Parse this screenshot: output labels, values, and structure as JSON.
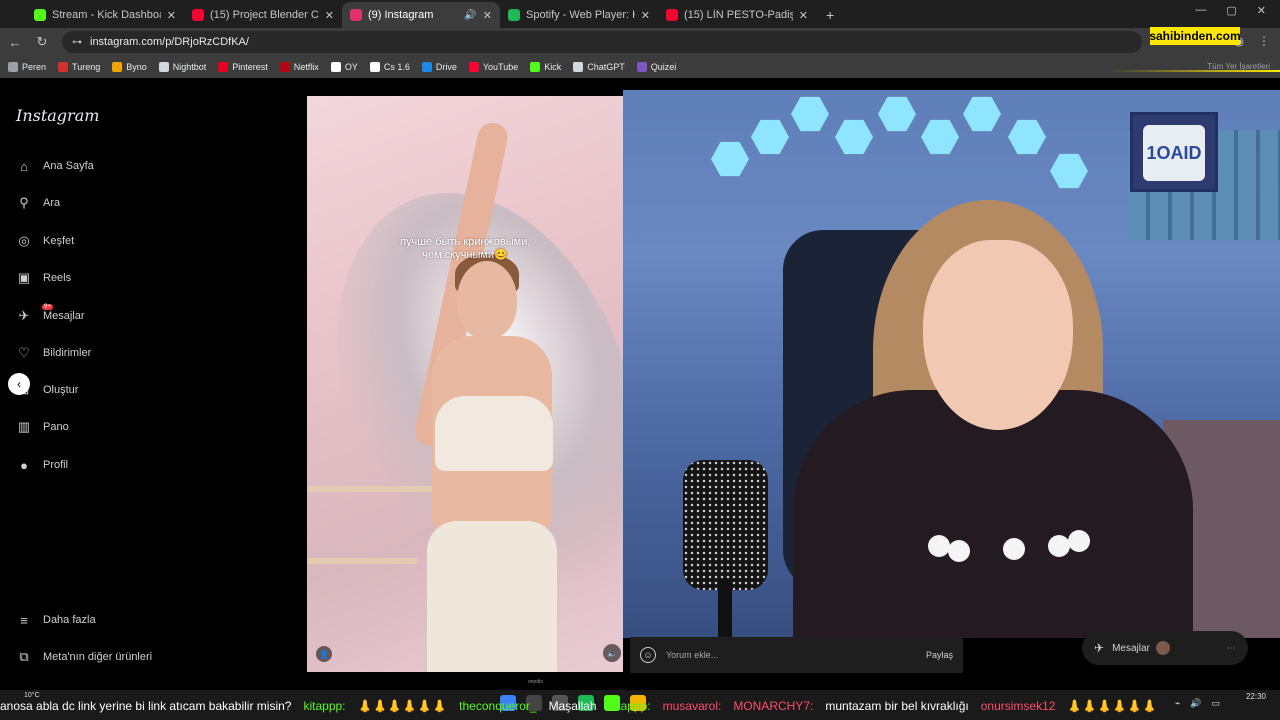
{
  "browser": {
    "tabs": [
      {
        "title": "Stream - Kick Dashboard",
        "icon": "kick-icon",
        "color": "#53fc18",
        "active": false
      },
      {
        "title": "(15) Project Blender CF Stream",
        "icon": "youtube-icon",
        "color": "#ff0033",
        "active": false
      },
      {
        "title": "(9) Instagram",
        "icon": "instagram-icon",
        "color": "#e1306c",
        "active": true
      },
      {
        "title": "Spotify - Web Player: Herkes iç",
        "icon": "spotify-icon",
        "color": "#1db954",
        "active": false
      },
      {
        "title": "(15) LİN PESTO-Padişah - YouTu",
        "icon": "youtube-icon",
        "color": "#ff0033",
        "active": false
      }
    ],
    "url": "instagram.com/p/DRjoRzCDfKA/",
    "bookmarks": [
      {
        "label": "Peren",
        "icon": "folder-icon",
        "color": "#9aa0a6"
      },
      {
        "label": "Tureng",
        "icon": "tureng-icon",
        "color": "#d32f2f"
      },
      {
        "label": "Byno",
        "icon": "byno-icon",
        "color": "#f0a500"
      },
      {
        "label": "Nightbot",
        "icon": "nightbot-icon",
        "color": "#cfd8dc"
      },
      {
        "label": "Pinterest",
        "icon": "pinterest-icon",
        "color": "#e60023"
      },
      {
        "label": "Netflix",
        "icon": "netflix-icon",
        "color": "#b20710"
      },
      {
        "label": "OY",
        "icon": "oy-icon",
        "color": "#ffffff"
      },
      {
        "label": "Cs 1.6",
        "icon": "cs-icon",
        "color": "#ffffff"
      },
      {
        "label": "Drive",
        "icon": "drive-icon",
        "color": "#1e88e5"
      },
      {
        "label": "YouTube",
        "icon": "youtube-icon",
        "color": "#ff0033"
      },
      {
        "label": "Kick",
        "icon": "kick-icon",
        "color": "#53fc18"
      },
      {
        "label": "ChatGPT",
        "icon": "chatgpt-icon",
        "color": "#cfd8dc"
      },
      {
        "label": "Quizei",
        "icon": "quizei-icon",
        "color": "#7e57c2"
      }
    ],
    "all_bookmarks": "Tüm Yer İşaretleri",
    "overlay_badge": "sahibinden.com"
  },
  "instagram": {
    "logo": "Instagram",
    "nav": [
      {
        "label": "Ana Sayfa",
        "icon": "home-icon",
        "glyph": "⌂"
      },
      {
        "label": "Ara",
        "icon": "search-icon",
        "glyph": "⚲"
      },
      {
        "label": "Keşfet",
        "icon": "explore-icon",
        "glyph": "◎"
      },
      {
        "label": "Reels",
        "icon": "reels-icon",
        "glyph": "▣"
      },
      {
        "label": "Mesajlar",
        "icon": "messages-icon",
        "glyph": "✈",
        "badge": "9+"
      },
      {
        "label": "Bildirimler",
        "icon": "heart-icon",
        "glyph": "♡"
      },
      {
        "label": "Oluştur",
        "icon": "create-icon",
        "glyph": "⊞"
      },
      {
        "label": "Pano",
        "icon": "dashboard-icon",
        "glyph": "▥"
      },
      {
        "label": "Profil",
        "icon": "avatar-icon",
        "glyph": "●"
      }
    ],
    "more": {
      "label": "Daha fazla",
      "icon": "menu-icon",
      "glyph": "≡"
    },
    "meta": {
      "label": "Meta'nın diğer ürünleri",
      "icon": "meta-icon",
      "glyph": "⧉"
    },
    "reel": {
      "caption_line1": "лучше быть кринжовыми,",
      "caption_line2": "чем скучными😊",
      "watermark": "onedio"
    },
    "comment": {
      "placeholder": "Yorum ekle...",
      "share": "Paylaş"
    },
    "messages_pill": "Mesajlar"
  },
  "webcam": {
    "frame_text": "1OAID"
  },
  "taskbar": {
    "weather": "10°C",
    "time": "22:30",
    "ticker": [
      {
        "text": "anosa abla dc link yerine bi link atıcam bakabilir misin?",
        "color": "#ffffff"
      },
      {
        "text": "kitappp:",
        "color": "#53fc18"
      },
      {
        "text": "👃👃👃👃👃👃",
        "color": "#ffffff"
      },
      {
        "text": "theconqueror_",
        "color": "#53fc18"
      },
      {
        "text": "Maşallah",
        "color": "#ffffff"
      },
      {
        "text": "kitappp:",
        "color": "#53fc18"
      },
      {
        "text": "musavarol:",
        "color": "#ff4d6d"
      },
      {
        "text": "MONARCHY7:",
        "color": "#ff4d6d"
      },
      {
        "text": "muntazam bir bel kıvraklığı",
        "color": "#ffffff"
      },
      {
        "text": "onursimsek12",
        "color": "#ff4d6d"
      },
      {
        "text": "👃👃👃👃👃👃",
        "color": "#ffffff"
      }
    ]
  }
}
